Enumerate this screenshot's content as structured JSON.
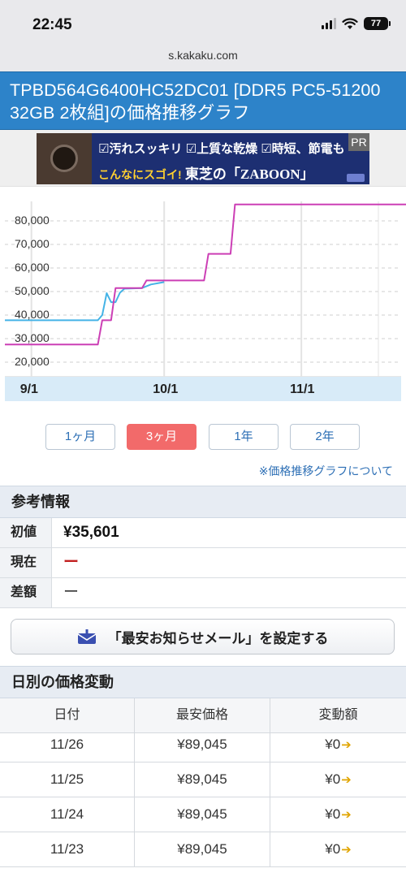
{
  "status_bar": {
    "time": "22:45",
    "battery": "77"
  },
  "url_bar": {
    "url": "s.kakaku.com"
  },
  "page_title": "TPBD564G6400HC52DC01 [DDR5 PC5-51200 32GB 2枚組]の価格推移グラフ",
  "ad": {
    "pr_label": "PR",
    "line1": "☑汚れスッキリ ☑上質な乾燥 ☑時短、節電も",
    "line2_a": "こんなにスゴイ!",
    "line2_b": " 東芝の「ZABOON」"
  },
  "chart_data": {
    "type": "line",
    "y_ticks": [
      "80,000",
      "70,000",
      "60,000",
      "50,000",
      "40,000",
      "30,000",
      "20,000"
    ],
    "x_ticks": [
      "9/1",
      "10/1",
      "11/1"
    ],
    "ylim": [
      17000,
      85500
    ],
    "grid": true,
    "series": [
      {
        "color": "#44b3e6",
        "points": [
          [
            "2023-08-26",
            37800
          ],
          [
            "2023-09-16",
            37800
          ],
          [
            "2023-09-17",
            40000
          ],
          [
            "2023-09-18",
            49300
          ],
          [
            "2023-09-19",
            45500
          ],
          [
            "2023-09-20",
            45500
          ],
          [
            "2023-09-21",
            49500
          ],
          [
            "2023-09-22",
            51200
          ],
          [
            "2023-09-26",
            51500
          ],
          [
            "2023-09-28",
            53000
          ],
          [
            "2023-10-01",
            54000
          ]
        ]
      },
      {
        "color": "#cc3fb5",
        "points": [
          [
            "2023-08-26",
            27500
          ],
          [
            "2023-09-16",
            27500
          ],
          [
            "2023-09-17",
            37800
          ],
          [
            "2023-09-19",
            37800
          ],
          [
            "2023-09-20",
            51500
          ],
          [
            "2023-09-26",
            51500
          ],
          [
            "2023-09-27",
            54700
          ],
          [
            "2023-10-10",
            54700
          ],
          [
            "2023-10-11",
            66000
          ],
          [
            "2023-10-16",
            66000
          ],
          [
            "2023-10-17",
            87000
          ],
          [
            "2023-11-26",
            87000
          ]
        ]
      }
    ]
  },
  "periods": [
    {
      "label": "1ヶ月",
      "active": false
    },
    {
      "label": "3ヶ月",
      "active": true
    },
    {
      "label": "1年",
      "active": false
    },
    {
      "label": "2年",
      "active": false
    }
  ],
  "graph_about_link": "※価格推移グラフについて",
  "reference": {
    "heading": "参考情報",
    "rows": [
      {
        "label": "初値",
        "value": "¥35,601"
      },
      {
        "label": "現在",
        "value": "ー"
      },
      {
        "label": "差額",
        "value": "ー"
      }
    ]
  },
  "mail_button_label": "「最安お知らせメール」を設定する",
  "daily": {
    "heading": "日別の価格変動",
    "columns": [
      "日付",
      "最安価格",
      "変動額"
    ],
    "rows": [
      {
        "date": "11/26",
        "price": "¥89,045",
        "change": "¥0"
      },
      {
        "date": "11/25",
        "price": "¥89,045",
        "change": "¥0"
      },
      {
        "date": "11/24",
        "price": "¥89,045",
        "change": "¥0"
      },
      {
        "date": "11/23",
        "price": "¥89,045",
        "change": "¥0"
      }
    ]
  }
}
